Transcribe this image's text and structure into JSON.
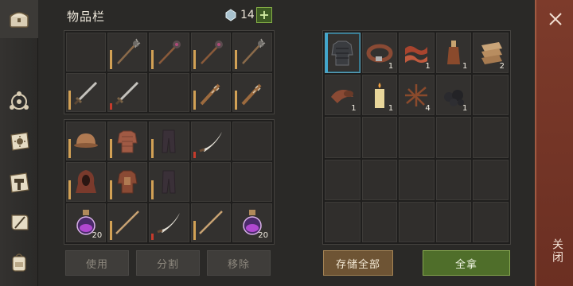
{
  "header": {
    "title": "物品栏",
    "gem_count": "14",
    "plus_label": "+"
  },
  "rail": {
    "icons": [
      "chest-icon",
      "compass-icon",
      "sun-scroll-icon",
      "hammer-icon",
      "scroll-feather-icon",
      "backpack-icon"
    ]
  },
  "buttons": {
    "use": "使用",
    "split": "分割",
    "remove": "移除",
    "store_all": "存储全部",
    "take_all": "全拿"
  },
  "close": {
    "label": "关闭"
  },
  "left_top_grid": [
    {
      "item": "",
      "empty": true
    },
    {
      "item": "mace-icon",
      "dur": "full"
    },
    {
      "item": "morningstar-icon",
      "dur": "full"
    },
    {
      "item": "morningstar-icon",
      "dur": "full"
    },
    {
      "item": "mace-icon",
      "dur": "full"
    },
    {
      "item": "sword-icon",
      "dur": "full"
    },
    {
      "item": "sword-icon",
      "dur": "red"
    },
    {
      "item": "",
      "empty": true
    },
    {
      "item": "spiked-club-icon",
      "dur": "full"
    },
    {
      "item": "spiked-club-icon",
      "dur": "full"
    }
  ],
  "left_bottom_grid": [
    {
      "item": "helmet-icon",
      "dur": "full"
    },
    {
      "item": "chainmail-icon",
      "dur": "full"
    },
    {
      "item": "pants-icon",
      "dur": "full"
    },
    {
      "item": "scimitar-icon",
      "dur": "red"
    },
    {
      "item": "",
      "empty": true
    },
    {
      "item": "hood-icon",
      "dur": "full"
    },
    {
      "item": "armor-vest-icon",
      "dur": "full"
    },
    {
      "item": "pants-icon",
      "dur": "full"
    },
    {
      "item": "",
      "empty": true
    },
    {
      "item": "",
      "empty": true
    },
    {
      "item": "potion-icon",
      "qty": "20"
    },
    {
      "item": "staff-icon",
      "dur": "full"
    },
    {
      "item": "scimitar-icon",
      "dur": "red"
    },
    {
      "item": "staff-icon",
      "dur": "full"
    },
    {
      "item": "potion-icon",
      "qty": "20"
    }
  ],
  "right_grid": [
    {
      "item": "chest-armor-icon",
      "selected": true
    },
    {
      "item": "belt-icon",
      "qty": "1"
    },
    {
      "item": "bacon-icon",
      "qty": "1"
    },
    {
      "item": "bottle-icon",
      "qty": "1"
    },
    {
      "item": "cloth-icon",
      "qty": "2"
    },
    {
      "item": "leather-roll-icon",
      "qty": "1"
    },
    {
      "item": "candle-icon",
      "qty": "1"
    },
    {
      "item": "twigs-icon",
      "qty": "4"
    },
    {
      "item": "coal-icon",
      "qty": "1"
    },
    {
      "item": "",
      "empty": true
    }
  ]
}
